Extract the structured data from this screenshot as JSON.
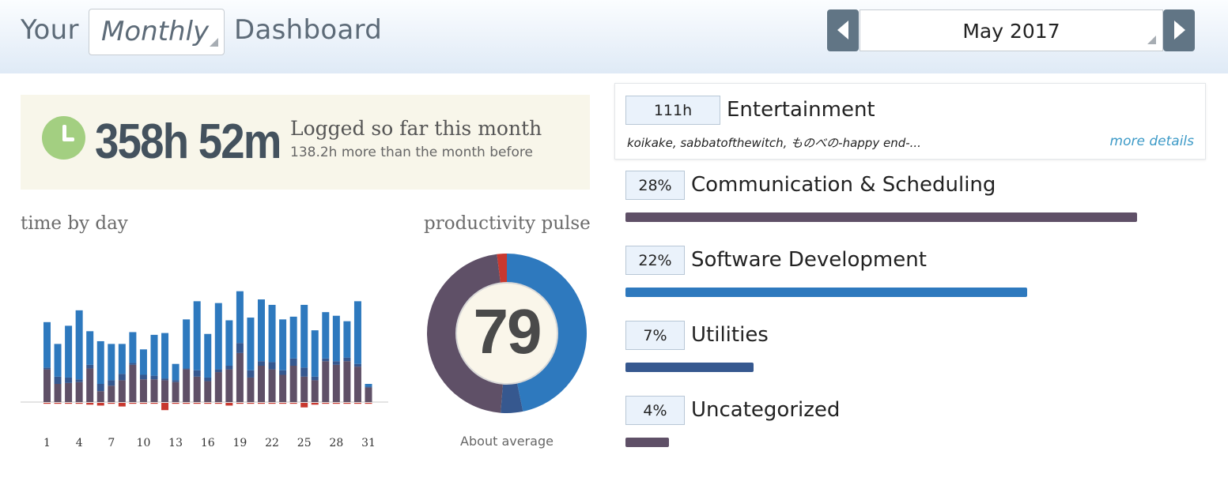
{
  "header": {
    "your_label": "Your",
    "period_value": "Monthly",
    "dashboard_label": "Dashboard",
    "month_value": "May 2017"
  },
  "logged": {
    "total": "358h 52m",
    "label": "Logged so far this month",
    "comparison": "138.2h more than the month before"
  },
  "time_by_day": {
    "title": "time by day"
  },
  "productivity_pulse": {
    "title": "productivity pulse",
    "value": "79",
    "caption": "About average"
  },
  "categories": {
    "top": {
      "value": "111h",
      "name": "Entertainment",
      "detail": "koikake, sabbatofthewitch, ものべの-happy end-...",
      "more_link": "more details"
    },
    "items": [
      {
        "value": "28%",
        "name": "Communication & Scheduling",
        "percent": 28,
        "color": "#5f5067"
      },
      {
        "value": "22%",
        "name": "Software Development",
        "percent": 22,
        "color": "#2e79be"
      },
      {
        "value": "7%",
        "name": "Utilities",
        "percent": 7,
        "color": "#36588f"
      },
      {
        "value": "4%",
        "name": "Uncategorized",
        "percent": 4,
        "color": "#5f5067"
      }
    ]
  },
  "colors": {
    "very_productive": "#2e79be",
    "productive": "#36588f",
    "neutral": "#5f5067",
    "distracting": "#c8382f",
    "accent_link": "#3d9ac7"
  },
  "chart_data": [
    {
      "type": "bar",
      "title": "time by day",
      "xlabel": "",
      "ylabel": "",
      "x": [
        1,
        2,
        3,
        4,
        5,
        6,
        7,
        8,
        9,
        10,
        11,
        12,
        13,
        14,
        15,
        16,
        17,
        18,
        19,
        20,
        21,
        22,
        23,
        24,
        25,
        26,
        27,
        28,
        29,
        30,
        31
      ],
      "tick_labels": [
        "1",
        "4",
        "7",
        "10",
        "13",
        "16",
        "19",
        "22",
        "25",
        "28",
        "31"
      ],
      "series": [
        {
          "color": "#2e79be",
          "values": [
            5.0,
            3.6,
            5.7,
            7.6,
            3.7,
            4.7,
            4.0,
            3.3,
            3.4,
            2.8,
            4.5,
            5.0,
            1.8,
            5.4,
            7.6,
            4.8,
            7.3,
            5.0,
            5.7,
            5.8,
            6.8,
            6.3,
            5.6,
            4.6,
            6.9,
            5.1,
            5.1,
            5.0,
            4.0,
            6.9,
            0.3
          ]
        },
        {
          "color": "#36588f",
          "values": [
            0.2,
            0.8,
            0.6,
            0.3,
            0.4,
            0.8,
            0.6,
            0.7,
            0.2,
            0.5,
            0.4,
            0.2,
            0.2,
            0.1,
            0.7,
            0.4,
            0.3,
            0.4,
            1.1,
            0.8,
            0.5,
            0.8,
            0.5,
            0.8,
            1.0,
            0.4,
            0.3,
            0.4,
            0.4,
            0.3,
            0.1
          ]
        },
        {
          "color": "#5f5067",
          "values": [
            3.6,
            2.0,
            2.1,
            2.2,
            3.7,
            1.2,
            1.8,
            2.4,
            4.1,
            2.5,
            2.5,
            2.4,
            2.2,
            3.6,
            2.8,
            2.3,
            3.3,
            3.6,
            5.4,
            2.7,
            4.0,
            3.6,
            3.0,
            4.0,
            2.8,
            2.4,
            4.5,
            4.1,
            4.5,
            3.9,
            1.6
          ]
        },
        {
          "color": "#c8382f",
          "values": [
            -0.1,
            -0.1,
            -0.1,
            -0.1,
            -0.2,
            -0.3,
            -0.1,
            -0.4,
            -0.1,
            -0.1,
            -0.1,
            -0.8,
            -0.1,
            -0.1,
            -0.1,
            -0.1,
            -0.1,
            -0.3,
            -0.1,
            -0.1,
            -0.1,
            -0.1,
            -0.1,
            -0.1,
            -0.5,
            -0.2,
            -0.1,
            -0.1,
            -0.1,
            -0.1,
            -0.1
          ]
        }
      ]
    },
    {
      "type": "pie",
      "title": "productivity pulse",
      "center_value": 79,
      "slices": [
        {
          "color": "#2e79be",
          "value": 47
        },
        {
          "color": "#36588f",
          "value": 4.5
        },
        {
          "color": "#5f5067",
          "value": 47
        },
        {
          "color": "#c8382f",
          "value": 2
        }
      ]
    }
  ]
}
